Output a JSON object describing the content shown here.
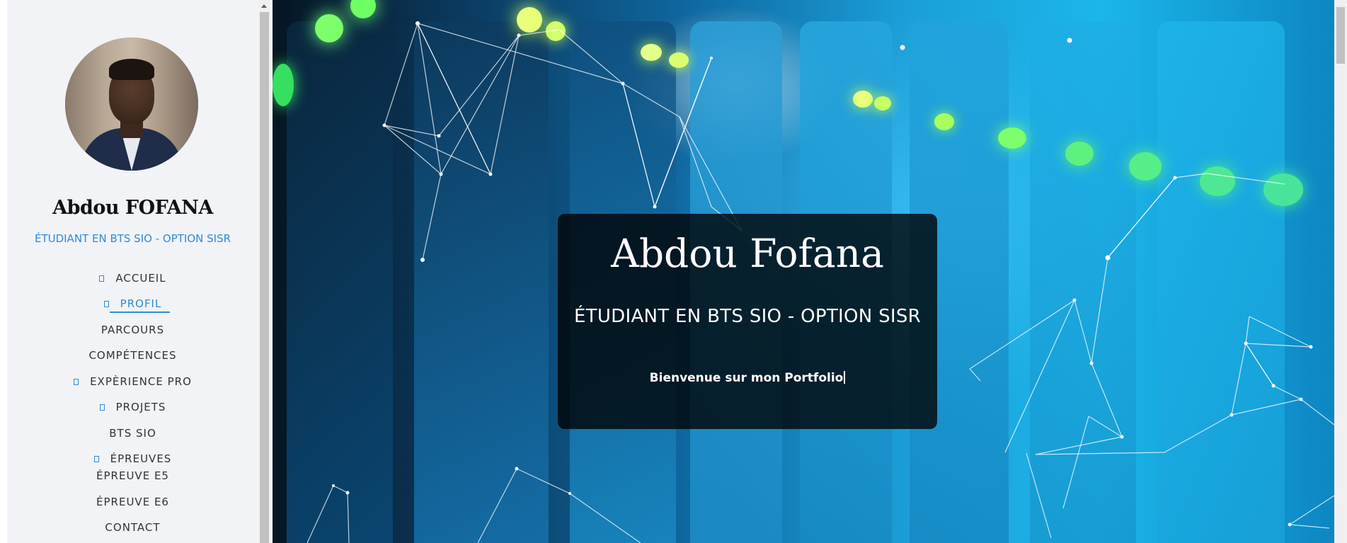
{
  "profile": {
    "name": "Abdou FOFANA",
    "subtitle": "ÉTUDIANT EN BTS SIO - OPTION SISR"
  },
  "nav": [
    {
      "label": "ACCUEIL",
      "icon": "home-icon",
      "active": false
    },
    {
      "label": "PROFIL",
      "icon": "user-icon",
      "active": true
    },
    {
      "label": "PARCOURS",
      "icon": "",
      "active": false
    },
    {
      "label": "COMPÉTENCES",
      "icon": "",
      "active": false
    },
    {
      "label": "EXPÈRIENCE PRO",
      "icon": "briefcase-icon",
      "active": false
    },
    {
      "label": "PROJETS",
      "icon": "folder-icon",
      "active": false
    },
    {
      "label": "BTS SIO",
      "icon": "",
      "active": false
    },
    {
      "label": "ÉPREUVES",
      "icon": "document-icon",
      "active": false
    },
    {
      "label": "ÉPREUVE E5",
      "icon": "",
      "active": false
    },
    {
      "label": "ÉPREUVE E6",
      "icon": "",
      "active": false
    },
    {
      "label": "CONTACT",
      "icon": "",
      "active": false
    }
  ],
  "hero": {
    "title": "Abdou Fofana",
    "subtitle": "ÉTUDIANT EN BTS SIO - OPTION SISR",
    "welcome": "Bienvenue sur mon Portfolio"
  },
  "colors": {
    "accent": "#2f8bd8",
    "sidebar_bg": "#f1f3f7"
  }
}
